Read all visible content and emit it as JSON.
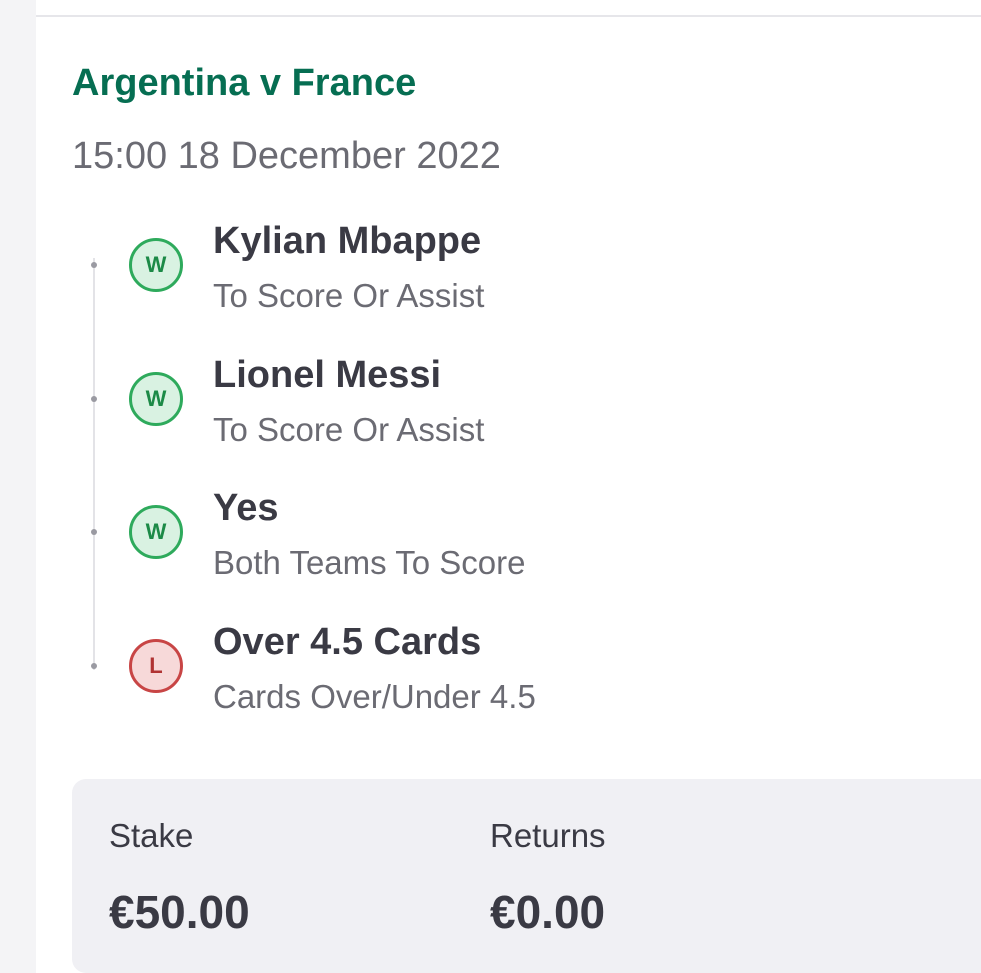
{
  "match": {
    "title": "Argentina v France",
    "datetime": "15:00 18 December 2022"
  },
  "selections": [
    {
      "name": "Kylian Mbappe",
      "market": "To Score Or Assist",
      "result": "W",
      "status": "win"
    },
    {
      "name": "Lionel Messi",
      "market": "To Score Or Assist",
      "result": "W",
      "status": "win"
    },
    {
      "name": "Yes",
      "market": "Both Teams To Score",
      "result": "W",
      "status": "win"
    },
    {
      "name": "Over 4.5 Cards",
      "market": "Cards Over/Under 4.5",
      "result": "L",
      "status": "loss"
    }
  ],
  "summary": {
    "stake_label": "Stake",
    "stake_value": "€50.00",
    "returns_label": "Returns",
    "returns_value": "€0.00"
  },
  "colors": {
    "title_green": "#066e52",
    "win_green": "#2eaa5c",
    "loss_red": "#c84545"
  }
}
